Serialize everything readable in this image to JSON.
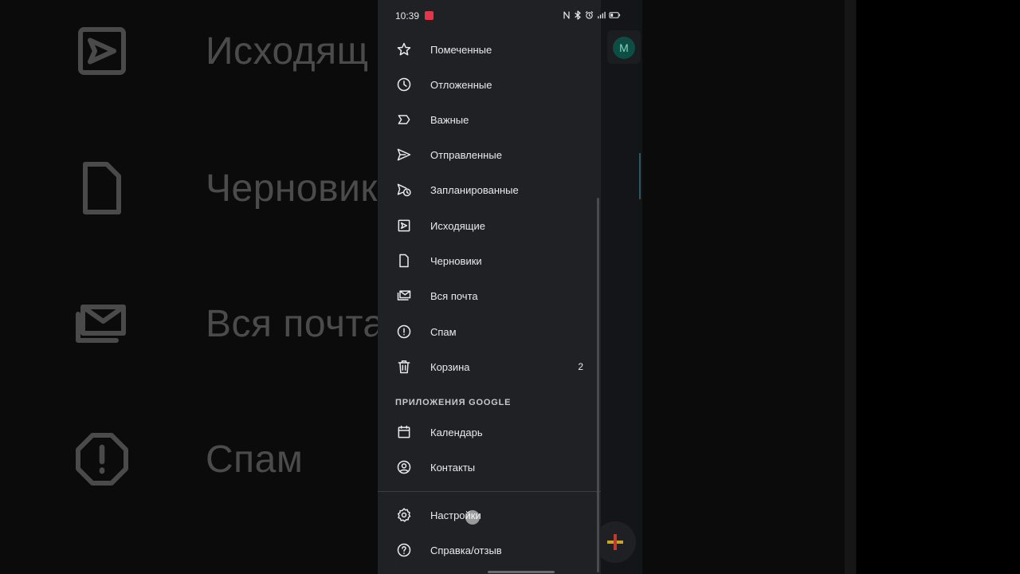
{
  "background": {
    "labels": [
      "Исходящ",
      "Черновик",
      "Вся почта",
      "Спам"
    ]
  },
  "status_bar": {
    "time": "10:39"
  },
  "account": {
    "avatar_letter": "M"
  },
  "drawer": {
    "items": [
      {
        "label": "Помеченные",
        "icon": "star-icon"
      },
      {
        "label": "Отложенные",
        "icon": "clock-icon"
      },
      {
        "label": "Важные",
        "icon": "label-important-icon"
      },
      {
        "label": "Отправленные",
        "icon": "send-icon"
      },
      {
        "label": "Запланированные",
        "icon": "schedule-send-icon"
      },
      {
        "label": "Исходящие",
        "icon": "outbox-icon"
      },
      {
        "label": "Черновики",
        "icon": "draft-icon"
      },
      {
        "label": "Вся почта",
        "icon": "all-mail-icon"
      },
      {
        "label": "Спам",
        "icon": "spam-icon"
      },
      {
        "label": "Корзина",
        "icon": "trash-icon",
        "count": "2"
      }
    ],
    "section_title": "ПРИЛОЖЕНИЯ GOOGLE",
    "apps": [
      {
        "label": "Календарь",
        "icon": "calendar-icon"
      },
      {
        "label": "Контакты",
        "icon": "contacts-icon"
      }
    ],
    "footer": [
      {
        "label": "Настройки",
        "icon": "gear-icon"
      },
      {
        "label": "Справка/отзыв",
        "icon": "help-icon"
      }
    ]
  },
  "colors": {
    "drawer_bg": "#202124",
    "text": "#e8eaed",
    "accent_avatar": "#0d4d44"
  }
}
